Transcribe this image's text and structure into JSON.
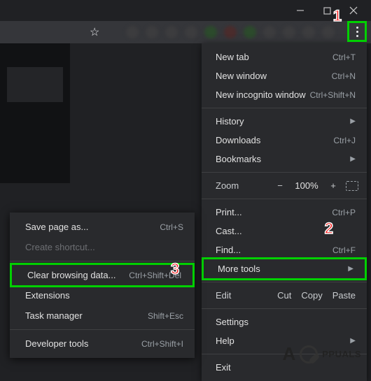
{
  "window": {
    "minimize": "—",
    "maximize": "☐",
    "close": "✕"
  },
  "toolbar": {
    "star": "☆"
  },
  "markers": {
    "one": "1",
    "two": "2",
    "three": "3"
  },
  "menu": {
    "new_tab": {
      "label": "New tab",
      "shortcut": "Ctrl+T"
    },
    "new_window": {
      "label": "New window",
      "shortcut": "Ctrl+N"
    },
    "new_incognito": {
      "label": "New incognito window",
      "shortcut": "Ctrl+Shift+N"
    },
    "history": {
      "label": "History"
    },
    "downloads": {
      "label": "Downloads",
      "shortcut": "Ctrl+J"
    },
    "bookmarks": {
      "label": "Bookmarks"
    },
    "zoom": {
      "label": "Zoom",
      "minus": "−",
      "value": "100%",
      "plus": "+"
    },
    "print": {
      "label": "Print...",
      "shortcut": "Ctrl+P"
    },
    "cast": {
      "label": "Cast..."
    },
    "find": {
      "label": "Find...",
      "shortcut": "Ctrl+F"
    },
    "more_tools": {
      "label": "More tools"
    },
    "edit": {
      "label": "Edit",
      "cut": "Cut",
      "copy": "Copy",
      "paste": "Paste"
    },
    "settings": {
      "label": "Settings"
    },
    "help": {
      "label": "Help"
    },
    "exit": {
      "label": "Exit"
    },
    "arrow": "▶"
  },
  "submenu": {
    "save_page": {
      "label": "Save page as...",
      "shortcut": "Ctrl+S"
    },
    "create_shortcut": {
      "label": "Create shortcut..."
    },
    "clear_browsing": {
      "label": "Clear browsing data...",
      "shortcut": "Ctrl+Shift+Del"
    },
    "extensions": {
      "label": "Extensions"
    },
    "task_manager": {
      "label": "Task manager",
      "shortcut": "Shift+Esc"
    },
    "developer_tools": {
      "label": "Developer tools",
      "shortcut": "Ctrl+Shift+I"
    }
  },
  "watermark": {
    "text": "PPUALS"
  }
}
